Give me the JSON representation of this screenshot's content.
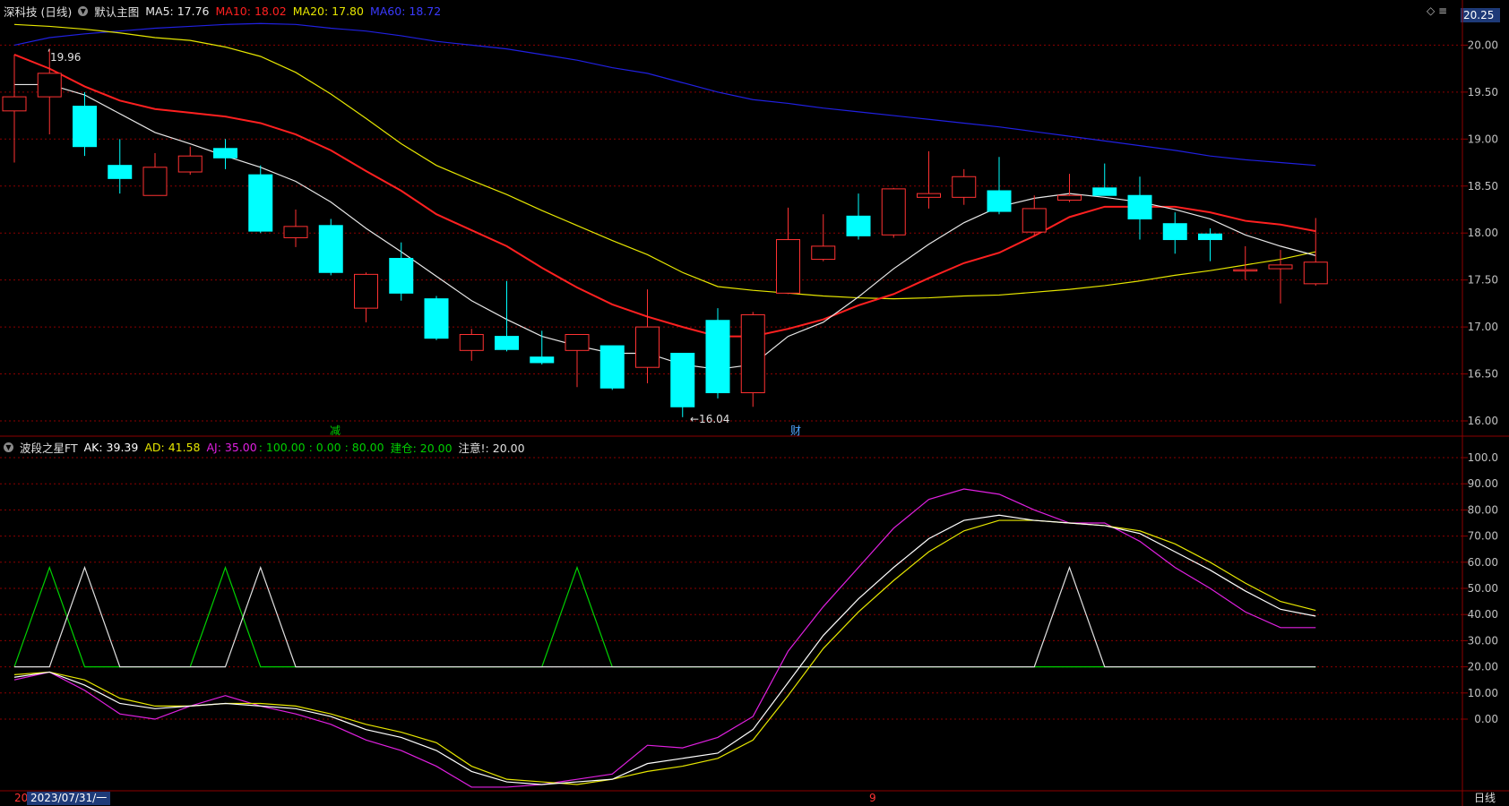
{
  "header": {
    "stock": "深科技 (日线)",
    "main_name": "默认主图",
    "ma5": "MA5: 17.76",
    "ma10": "MA10: 18.02",
    "ma20": "MA20: 17.80",
    "ma60": "MA60: 18.72"
  },
  "sub_header": {
    "name": "波段之星FT",
    "ak": "AK: 39.39",
    "ad": "AD: 41.58",
    "aj": "AJ: 35.00",
    "levels": ": 100.00 : 0.00 : 80.00",
    "jiancang": "建仓: 20.00",
    "zhuyi": "注意!: 20.00"
  },
  "current_price_box": "20.25",
  "top_icons": "◇ ≡",
  "bottom": {
    "left": "20",
    "date": "2023/07/31/一",
    "mid": "9",
    "right": "日线"
  },
  "annotations": {
    "high": "19.96",
    "low": "←16.04",
    "mark_jian": "减",
    "mark_cai": "财"
  },
  "colors": {
    "up": "#ff3232",
    "down": "#00ffff",
    "ma5": "#e8e8e8",
    "ma10": "#ff2020",
    "ma20": "#e6e600",
    "ma60": "#2020e0",
    "ak": "#ffffff",
    "ad": "#e6e600",
    "aj": "#e020e0",
    "grid": "#8b0000",
    "green": "#00d000"
  },
  "chart_data": [
    {
      "type": "candlestick",
      "y_ticks": [
        "20.00",
        "19.50",
        "19.00",
        "18.50",
        "18.00",
        "17.50",
        "17.00",
        "16.50",
        "16.00"
      ],
      "ylim": [
        15.9,
        20.25
      ],
      "candles": [
        {
          "o": 19.3,
          "h": 19.9,
          "l": 18.75,
          "c": 19.45
        },
        {
          "o": 19.45,
          "h": 19.96,
          "l": 19.05,
          "c": 19.7
        },
        {
          "o": 19.35,
          "h": 19.5,
          "l": 18.82,
          "c": 18.92
        },
        {
          "o": 18.72,
          "h": 19.0,
          "l": 18.42,
          "c": 18.58
        },
        {
          "o": 18.4,
          "h": 18.85,
          "l": 18.4,
          "c": 18.7
        },
        {
          "o": 18.65,
          "h": 18.92,
          "l": 18.62,
          "c": 18.82
        },
        {
          "o": 18.9,
          "h": 19.0,
          "l": 18.68,
          "c": 18.8
        },
        {
          "o": 18.62,
          "h": 18.72,
          "l": 18.0,
          "c": 18.02
        },
        {
          "o": 17.95,
          "h": 18.25,
          "l": 17.85,
          "c": 18.07
        },
        {
          "o": 18.08,
          "h": 18.15,
          "l": 17.55,
          "c": 17.58
        },
        {
          "o": 17.2,
          "h": 17.58,
          "l": 17.05,
          "c": 17.56
        },
        {
          "o": 17.73,
          "h": 17.9,
          "l": 17.28,
          "c": 17.36
        },
        {
          "o": 17.3,
          "h": 17.33,
          "l": 16.86,
          "c": 16.88
        },
        {
          "o": 16.75,
          "h": 16.98,
          "l": 16.64,
          "c": 16.92
        },
        {
          "o": 16.9,
          "h": 17.49,
          "l": 16.74,
          "c": 16.76
        },
        {
          "o": 16.68,
          "h": 16.96,
          "l": 16.6,
          "c": 16.62
        },
        {
          "o": 16.75,
          "h": 16.92,
          "l": 16.36,
          "c": 16.92
        },
        {
          "o": 16.8,
          "h": 16.8,
          "l": 16.33,
          "c": 16.35
        },
        {
          "o": 16.57,
          "h": 17.4,
          "l": 16.4,
          "c": 17.0
        },
        {
          "o": 16.72,
          "h": 16.72,
          "l": 16.04,
          "c": 16.15
        },
        {
          "o": 17.07,
          "h": 17.2,
          "l": 16.24,
          "c": 16.3
        },
        {
          "o": 16.3,
          "h": 17.16,
          "l": 16.15,
          "c": 17.13
        },
        {
          "o": 17.36,
          "h": 18.27,
          "l": 17.35,
          "c": 17.93
        },
        {
          "o": 17.72,
          "h": 18.2,
          "l": 17.7,
          "c": 17.86
        },
        {
          "o": 18.18,
          "h": 18.42,
          "l": 17.93,
          "c": 17.97
        },
        {
          "o": 17.98,
          "h": 18.48,
          "l": 17.95,
          "c": 18.47
        },
        {
          "o": 18.38,
          "h": 18.87,
          "l": 18.26,
          "c": 18.42
        },
        {
          "o": 18.38,
          "h": 18.68,
          "l": 18.3,
          "c": 18.6
        },
        {
          "o": 18.45,
          "h": 18.81,
          "l": 18.2,
          "c": 18.23
        },
        {
          "o": 18.01,
          "h": 18.4,
          "l": 17.97,
          "c": 18.26
        },
        {
          "o": 18.35,
          "h": 18.63,
          "l": 18.33,
          "c": 18.4
        },
        {
          "o": 18.48,
          "h": 18.74,
          "l": 18.4,
          "c": 18.4
        },
        {
          "o": 18.4,
          "h": 18.6,
          "l": 17.93,
          "c": 18.15
        },
        {
          "o": 18.1,
          "h": 18.22,
          "l": 17.78,
          "c": 17.93
        },
        {
          "o": 17.99,
          "h": 18.05,
          "l": 17.7,
          "c": 17.93
        },
        {
          "o": 17.6,
          "h": 17.86,
          "l": 17.5,
          "c": 17.61
        },
        {
          "o": 17.62,
          "h": 17.82,
          "l": 17.25,
          "c": 17.66
        },
        {
          "o": 17.46,
          "h": 18.16,
          "l": 17.44,
          "c": 17.69
        }
      ],
      "ma5": [
        19.58,
        19.58,
        19.47,
        19.27,
        19.07,
        18.95,
        18.82,
        18.7,
        18.55,
        18.33,
        18.05,
        17.8,
        17.54,
        17.28,
        17.08,
        16.9,
        16.8,
        16.72,
        16.72,
        16.6,
        16.55,
        16.6,
        16.9,
        17.05,
        17.32,
        17.62,
        17.88,
        18.11,
        18.28,
        18.37,
        18.42,
        18.38,
        18.33,
        18.25,
        18.15,
        17.98,
        17.86,
        17.76
      ],
      "ma10": [
        19.9,
        19.75,
        19.56,
        19.41,
        19.32,
        19.28,
        19.24,
        19.17,
        19.05,
        18.88,
        18.66,
        18.45,
        18.2,
        18.03,
        17.86,
        17.63,
        17.42,
        17.24,
        17.11,
        17.0,
        16.9,
        16.9,
        16.98,
        17.08,
        17.23,
        17.35,
        17.52,
        17.68,
        17.79,
        17.97,
        18.17,
        18.28,
        18.28,
        18.28,
        18.22,
        18.13,
        18.09,
        18.02
      ],
      "ma20": [
        20.22,
        20.2,
        20.17,
        20.13,
        20.08,
        20.05,
        19.98,
        19.88,
        19.71,
        19.48,
        19.22,
        18.95,
        18.72,
        18.56,
        18.41,
        18.24,
        18.08,
        17.92,
        17.77,
        17.58,
        17.43,
        17.39,
        17.36,
        17.33,
        17.31,
        17.3,
        17.31,
        17.33,
        17.34,
        17.37,
        17.4,
        17.44,
        17.49,
        17.55,
        17.6,
        17.66,
        17.72,
        17.8
      ],
      "ma60": [
        20.0,
        20.08,
        20.12,
        20.15,
        20.18,
        20.2,
        20.22,
        20.23,
        20.22,
        20.18,
        20.15,
        20.1,
        20.04,
        20.0,
        19.96,
        19.9,
        19.84,
        19.76,
        19.7,
        19.6,
        19.5,
        19.42,
        19.38,
        19.33,
        19.29,
        19.25,
        19.21,
        19.17,
        19.13,
        19.08,
        19.03,
        18.98,
        18.93,
        18.88,
        18.82,
        18.78,
        18.75,
        18.72
      ]
    },
    {
      "type": "line",
      "name": "波段之星FT",
      "y_ticks": [
        "100.0",
        "90.00",
        "80.00",
        "70.00",
        "60.00",
        "50.00",
        "40.00",
        "30.00",
        "20.00",
        "10.00",
        "0.00"
      ],
      "ylim": [
        -31,
        105
      ],
      "series": [
        {
          "name": "AK",
          "values": [
            16,
            18,
            13,
            6,
            4,
            5,
            6,
            5,
            4,
            1,
            -4,
            -7,
            -12,
            -20,
            -24,
            -25,
            -24,
            -23,
            -17,
            -15,
            -13,
            -4,
            14,
            32,
            46,
            58,
            69,
            76,
            78,
            76,
            75,
            74,
            71,
            64,
            57,
            49,
            42,
            39.39
          ]
        },
        {
          "name": "AD",
          "values": [
            17,
            18,
            15,
            8,
            5,
            5,
            6,
            6,
            5,
            2,
            -2,
            -5,
            -9,
            -18,
            -23,
            -24,
            -25,
            -23,
            -20,
            -18,
            -15,
            -8,
            9,
            27,
            41,
            53,
            64,
            72,
            76,
            76,
            75,
            74,
            72,
            67,
            60,
            52,
            45,
            41.58
          ]
        },
        {
          "name": "AJ",
          "values": [
            15,
            18,
            11,
            2,
            0,
            5,
            9,
            5,
            2,
            -2,
            -8,
            -12,
            -18,
            -26,
            -26,
            -25,
            -23,
            -21,
            -10,
            -11,
            -7,
            1,
            26,
            43,
            58,
            73,
            84,
            88,
            86,
            80,
            75,
            75,
            68,
            58,
            50,
            41,
            35,
            35.0
          ]
        },
        {
          "name": "建仓",
          "values": [
            20,
            58,
            20,
            20,
            20,
            20,
            58,
            20,
            20,
            20,
            20,
            20,
            20,
            20,
            20,
            20,
            58,
            20,
            20,
            20,
            20,
            20,
            20,
            20,
            20,
            20,
            20,
            20,
            20,
            20,
            20,
            20,
            20,
            20,
            20,
            20,
            20,
            20
          ]
        },
        {
          "name": "注意!",
          "values": [
            20,
            20,
            58,
            20,
            20,
            20,
            20,
            58,
            20,
            20,
            20,
            20,
            20,
            20,
            20,
            20,
            20,
            20,
            20,
            20,
            20,
            20,
            20,
            20,
            20,
            20,
            20,
            20,
            20,
            20,
            58,
            20,
            20,
            20,
            20,
            20,
            20,
            20
          ]
        }
      ]
    }
  ]
}
